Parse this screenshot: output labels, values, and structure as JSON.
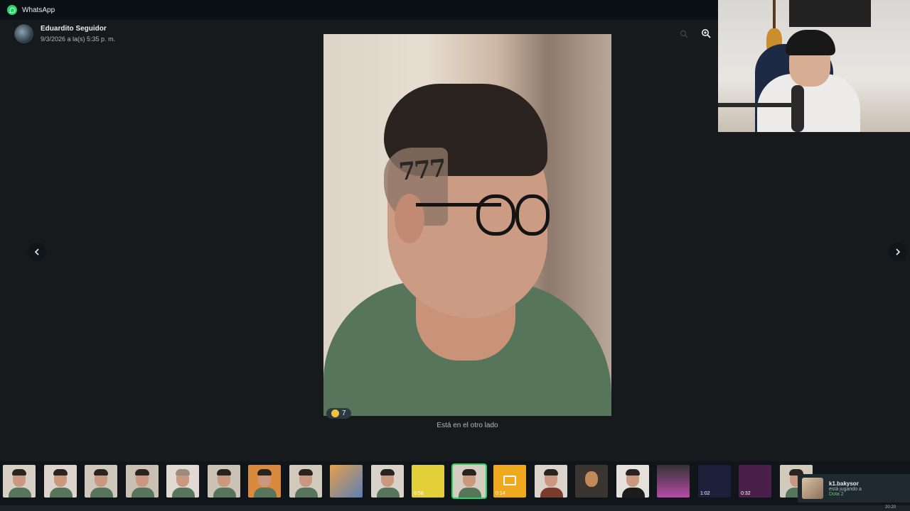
{
  "app": {
    "title": "WhatsApp",
    "accent": "#25d366"
  },
  "sender": {
    "name": "Eduardito Seguidor",
    "date": "9/3/2026 a la(s) 5:35 p. m."
  },
  "toolbar": {
    "icons": [
      "search-icon",
      "zoom-in-icon"
    ]
  },
  "photo": {
    "tattoo_text": "777"
  },
  "reaction": {
    "count": "7",
    "emoji": "laughing-emoji"
  },
  "caption": "Está en el otro lado",
  "navigation": {
    "prev_icon": "chevron-left-icon",
    "next_icon": "chevron-right-icon"
  },
  "filmstrip": {
    "durations": [
      "0:58",
      "0:14",
      "1:02",
      "0:32"
    ]
  },
  "notification": {
    "name": "k1.bakysor",
    "status": "está jugando a",
    "game": "Dota 2"
  },
  "taskbar": {
    "time": "20:20"
  }
}
